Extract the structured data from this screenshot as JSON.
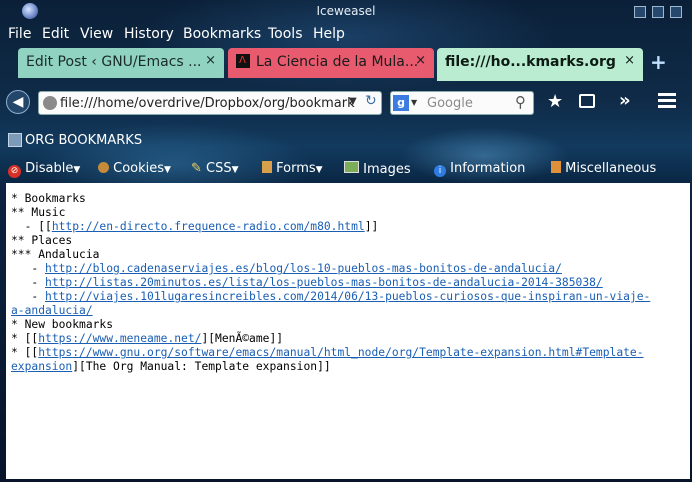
{
  "window": {
    "title": "Iceweasel"
  },
  "menubar": [
    "File",
    "Edit",
    "View",
    "History",
    "Bookmarks",
    "Tools",
    "Help"
  ],
  "tabs": [
    {
      "label": "Edit Post ‹ GNU/Emacs ...",
      "close": "×",
      "color": "#8fd3c0"
    },
    {
      "label": "La Ciencia de la Mula...",
      "close": "×",
      "color": "#e85a6e"
    },
    {
      "label": "file:///ho...kmarks.org",
      "close": "×",
      "color": "#b9ecd0",
      "active": true
    }
  ],
  "new_tab": "+",
  "navbar": {
    "url": "file:///home/overdrive/Dropbox/org/bookmark",
    "search_placeholder": "Google"
  },
  "bookmarks_toolbar": {
    "label": "ORG BOOKMARKS"
  },
  "webdev": [
    {
      "label": "Disable",
      "icon": "disable-icon"
    },
    {
      "label": "Cookies",
      "icon": "cookie-icon"
    },
    {
      "label": "CSS",
      "icon": "css-icon"
    },
    {
      "label": "Forms",
      "icon": "forms-icon"
    },
    {
      "label": "Images",
      "icon": "image-icon"
    },
    {
      "label": "Information",
      "icon": "info-icon"
    },
    {
      "label": "Miscellaneous",
      "icon": "misc-icon"
    }
  ],
  "document": {
    "l1": "* Bookmarks",
    "l2": "** Music",
    "l3_pre": "  - [[",
    "l3_link": "http://en-directo.frequence-radio.com/m80.html",
    "l3_post": "]]",
    "l4": "** Places",
    "l5": "*** Andalucia",
    "l6_pre": "   - ",
    "l6_link": "http://blog.cadenaserviajes.es/blog/los-10-pueblos-mas-bonitos-de-andalucia/",
    "l7_pre": "   - ",
    "l7_link": "http://listas.20minutos.es/lista/los-pueblos-mas-bonitos-de-andalucia-2014-385038/",
    "l8_pre": "   - ",
    "l8_link": "http://viajes.101lugaresincreibles.com/2014/06/13-pueblos-curiosos-que-inspiran-un-viaje-",
    "l9_link": "a-andalucia/",
    "l10": "* New bookmarks",
    "l11_pre": "* [[",
    "l11_link": "https://www.meneame.net/",
    "l11_post": "][MenÃ©ame]]",
    "l12_pre": "* [[",
    "l12_link": "https://www.gnu.org/software/emacs/manual/html_node/org/Template-expansion.html#Template-",
    "l13_link": "expansion",
    "l13_post": "][The Org Manual: Template expansion]]"
  }
}
